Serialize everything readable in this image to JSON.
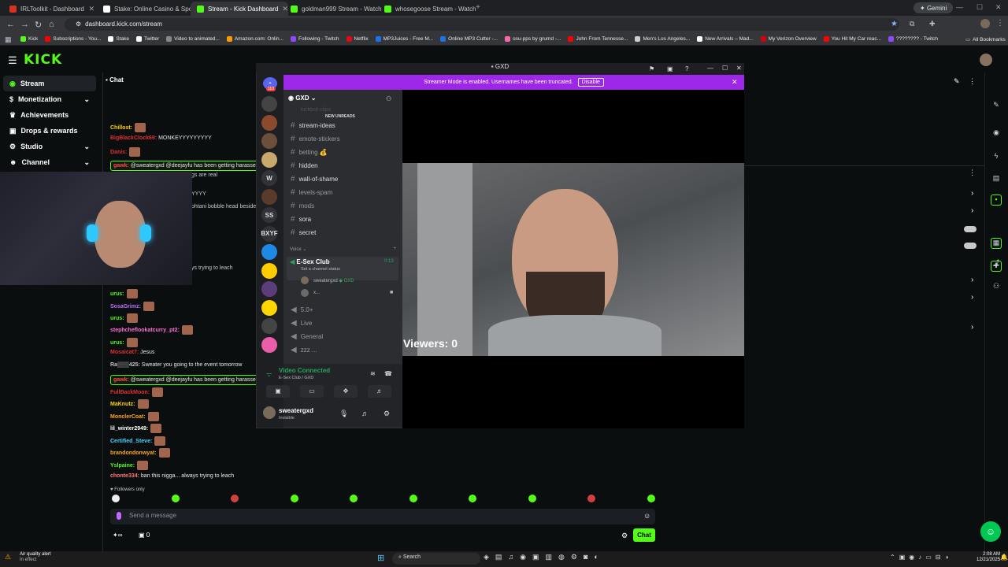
{
  "browser": {
    "tabs": [
      {
        "title": "IRLToolkit - Dashboard",
        "color": "#d93025"
      },
      {
        "title": "Stake: Online Casino & Sports",
        "color": "#ffffff"
      },
      {
        "title": "Stream - Kick Dashboard",
        "color": "#53fc18",
        "active": true
      },
      {
        "title": "goldman999 Stream - Watch Li",
        "color": "#53fc18"
      },
      {
        "title": "whosegoose Stream - Watch Li",
        "color": "#53fc18"
      }
    ],
    "new_tab": "+",
    "gemini": "Gemini",
    "url": "dashboard.kick.com/stream",
    "bookmarks": [
      {
        "label": "Kick",
        "color": "#53fc18"
      },
      {
        "label": "Subscriptions - You...",
        "color": "#ff0000"
      },
      {
        "label": "Stake",
        "color": "#ffffff"
      },
      {
        "label": "Twitter",
        "color": "#ffffff"
      },
      {
        "label": "Video to animated...",
        "color": "#888888"
      },
      {
        "label": "Amazon.com: Onlin...",
        "color": "#ff9900"
      },
      {
        "label": "Following - Twitch",
        "color": "#9146ff"
      },
      {
        "label": "Netflix",
        "color": "#e50914"
      },
      {
        "label": "MP3Juices - Free M...",
        "color": "#1a73e8"
      },
      {
        "label": "Online MP3 Cutter -...",
        "color": "#1a73e8"
      },
      {
        "label": "osu-pps by grumd -...",
        "color": "#ff66aa"
      },
      {
        "label": "John From Tennesse...",
        "color": "#ff0000"
      },
      {
        "label": "Men's Los Angeles...",
        "color": "#cccccc"
      },
      {
        "label": "New Arrivals – Mad...",
        "color": "#ffffff"
      },
      {
        "label": "My Verizon Overview",
        "color": "#cd040b"
      },
      {
        "label": "You Hit My Car reac...",
        "color": "#ff0000"
      },
      {
        "label": "???????? - Twitch",
        "color": "#9146ff"
      }
    ],
    "all_bookmarks": "All Bookmarks"
  },
  "kick": {
    "logo": "KICK",
    "nav": [
      {
        "label": "Stream",
        "active": true,
        "icon": "broadcast-icon"
      },
      {
        "label": "Monetization",
        "chevron": true,
        "icon": "dollar-icon"
      },
      {
        "label": "Achievements",
        "icon": "trophy-icon"
      },
      {
        "label": "Drops & rewards",
        "icon": "gift-icon"
      },
      {
        "label": "Studio",
        "chevron": true,
        "icon": "gear-icon"
      },
      {
        "label": "Channel",
        "chevron": true,
        "icon": "person-icon"
      }
    ],
    "chat_title": "Chat",
    "messages": [
      {
        "user": "Chillost:",
        "text": "",
        "ucolor": "#ffd000",
        "emote": true
      },
      {
        "user": "BigBlackClock69:",
        "text": " MONKEYYYYYYYYY",
        "ucolor": "#e22f2f"
      },
      {
        "user": "Danis:",
        "text": "",
        "ucolor": "#e22f2f",
        "emote": true
      },
      {
        "user": "gawk:",
        "text": " @sweatergxd @deejayfu has been getting harassed l",
        "ucolor": "#ff4a4a",
        "hl": true
      },
      {
        "user": "",
        "text": "gs are real",
        "ucolor": "#888"
      },
      {
        "user": "",
        "text": "YYYY",
        "ucolor": "#888"
      },
      {
        "user": "",
        "text": "ohtani bobble head beside",
        "ucolor": "#888"
      },
      {
        "user": "",
        "text": "ys trying to leach",
        "ucolor": "#888"
      },
      {
        "user": "urus:",
        "text": "",
        "ucolor": "#53fc18",
        "emote": true
      },
      {
        "user": "SosaGrimz:",
        "text": "",
        "ucolor": "#c06bff",
        "emote": true
      },
      {
        "user": "urus:",
        "text": "",
        "ucolor": "#53fc18",
        "emote": true
      },
      {
        "user": "stephcheflookatcurry_pt2:",
        "text": "",
        "ucolor": "#ff6bd6",
        "emote": true
      },
      {
        "user": "urus:",
        "text": "",
        "ucolor": "#53fc18",
        "emote": true
      },
      {
        "user": "Mosaicat7:",
        "text": " Jesus",
        "ucolor": "#e22f2f"
      },
      {
        "user": "Ra▒▒▒425:",
        "text": " Sweater you going to the event tomorrow",
        "ucolor": "#c3c3c3"
      },
      {
        "user": "gawk:",
        "text": " @sweatergxd @deejayfu has been getting harassed l",
        "ucolor": "#ff4a4a",
        "hl": true
      },
      {
        "user": "FullBackMoon:",
        "text": "",
        "ucolor": "#e22f2f",
        "emote": true
      },
      {
        "user": "MaKnutz:",
        "text": "",
        "ucolor": "#ffd000",
        "emote": true
      },
      {
        "user": "MonclerCoat:",
        "text": "",
        "ucolor": "#ffa51a",
        "emote": true
      },
      {
        "user": "lil_winter2949:",
        "text": "",
        "ucolor": "#ffffff",
        "emote": true
      },
      {
        "user": "Certified_Steve:",
        "text": "",
        "ucolor": "#4ad6ff",
        "emote": true
      },
      {
        "user": "brandondonwyat:",
        "text": "",
        "ucolor": "#ffa51a",
        "emote": true
      },
      {
        "user": "Yslpaine:",
        "text": "",
        "ucolor": "#53fc18",
        "emote": true
      },
      {
        "user": "chonte334:",
        "text": " ban this nigga... always trying to leach",
        "ucolor": "#ff7a7a"
      }
    ],
    "followers_only": "Followers only",
    "send_placeholder": "Send a message",
    "chat_button": "Chat",
    "bottom_counts": [
      "0",
      "0"
    ],
    "air_quality": "Air quality alert",
    "air_quality_sub": "In effect"
  },
  "discord": {
    "title": "GXD",
    "streamer_banner": "Streamer Mode is enabled. Usernames have been truncated.",
    "disable": "Disable",
    "server_badge": "110",
    "server_name": "GXD",
    "hidden_channel": "kickbot-clips",
    "new_unreads": "NEW UNREADS",
    "channels": [
      {
        "name": "stream-ideas",
        "bright": true
      },
      {
        "name": "emote-stickers",
        "bright": false
      },
      {
        "name": "betting 💰",
        "bright": false
      },
      {
        "name": "hidden",
        "bright": true
      },
      {
        "name": "wall-of-shame",
        "bright": true
      },
      {
        "name": "levels-spam",
        "bright": false
      },
      {
        "name": "mods",
        "bright": false
      },
      {
        "name": "sora",
        "bright": true
      },
      {
        "name": "secret",
        "bright": true
      }
    ],
    "voice_label": "Voice",
    "voice_channel": "E-Sex Club",
    "voice_time": "0:13",
    "voice_status": "Set a channel status",
    "voice_members": [
      "sweatergxd",
      "x..."
    ],
    "member_tag": "GXD",
    "voice_channels": [
      "5.0+",
      "Live",
      "General",
      "zzz ..."
    ],
    "video_connected": "Video Connected",
    "video_sub": "E-Sex Club / GXD",
    "user_name": "sweatergxd",
    "user_status": "Invisible",
    "viewers": "Viewers: 0",
    "servers": [
      "",
      "",
      "",
      "",
      "",
      "W",
      "",
      "SS",
      "BXYF",
      "",
      "",
      "",
      "",
      "",
      ""
    ]
  },
  "taskbar": {
    "search": "Search",
    "time": "2:08 AM",
    "date": "12/21/2025"
  }
}
